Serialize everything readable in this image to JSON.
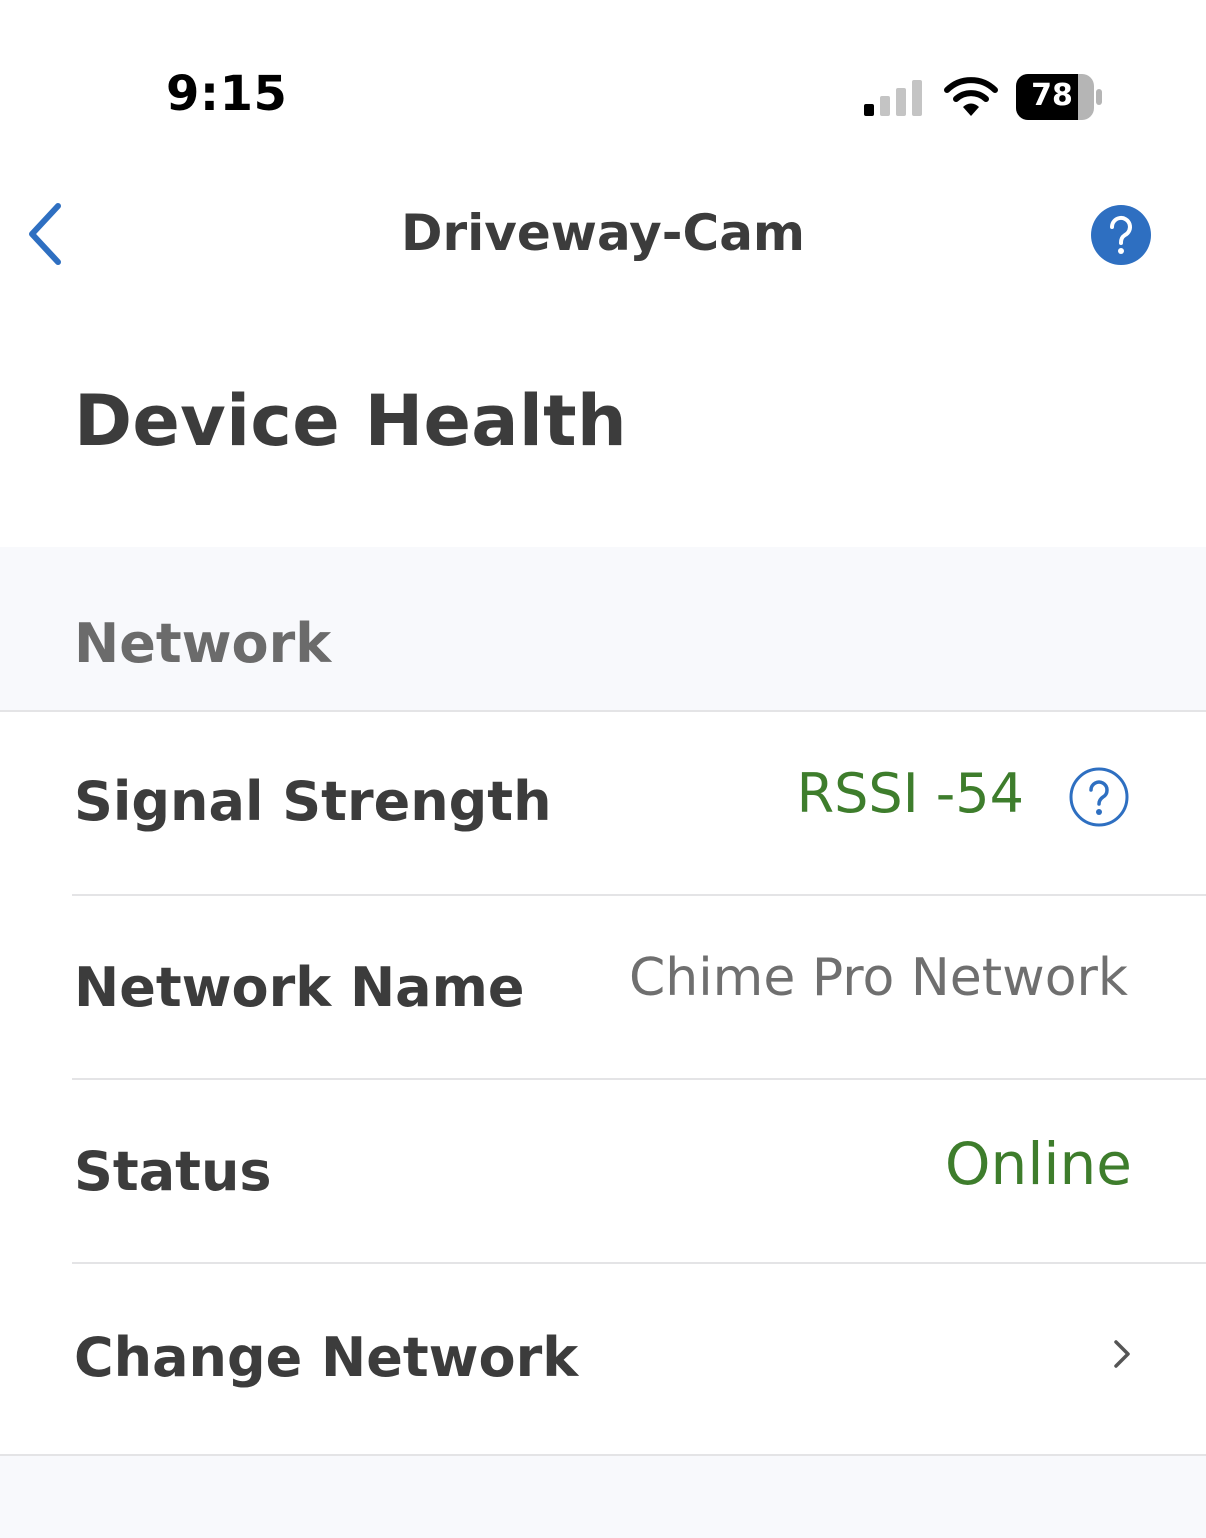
{
  "status_bar": {
    "time": "9:15",
    "battery": "78"
  },
  "nav": {
    "title": "Driveway-Cam",
    "accent_color": "#2e6fc1"
  },
  "page": {
    "title": "Device Health"
  },
  "section": {
    "title": "Network",
    "rows": [
      {
        "label": "Signal Strength",
        "value": "RSSI -54",
        "value_color": "#3e7d2c"
      },
      {
        "label": "Network Name",
        "value": "Chime Pro Network",
        "value_color": "#6f6f6f"
      },
      {
        "label": "Status",
        "value": "Online",
        "value_color": "#3e7d2c"
      },
      {
        "label": "Change Network"
      }
    ]
  }
}
